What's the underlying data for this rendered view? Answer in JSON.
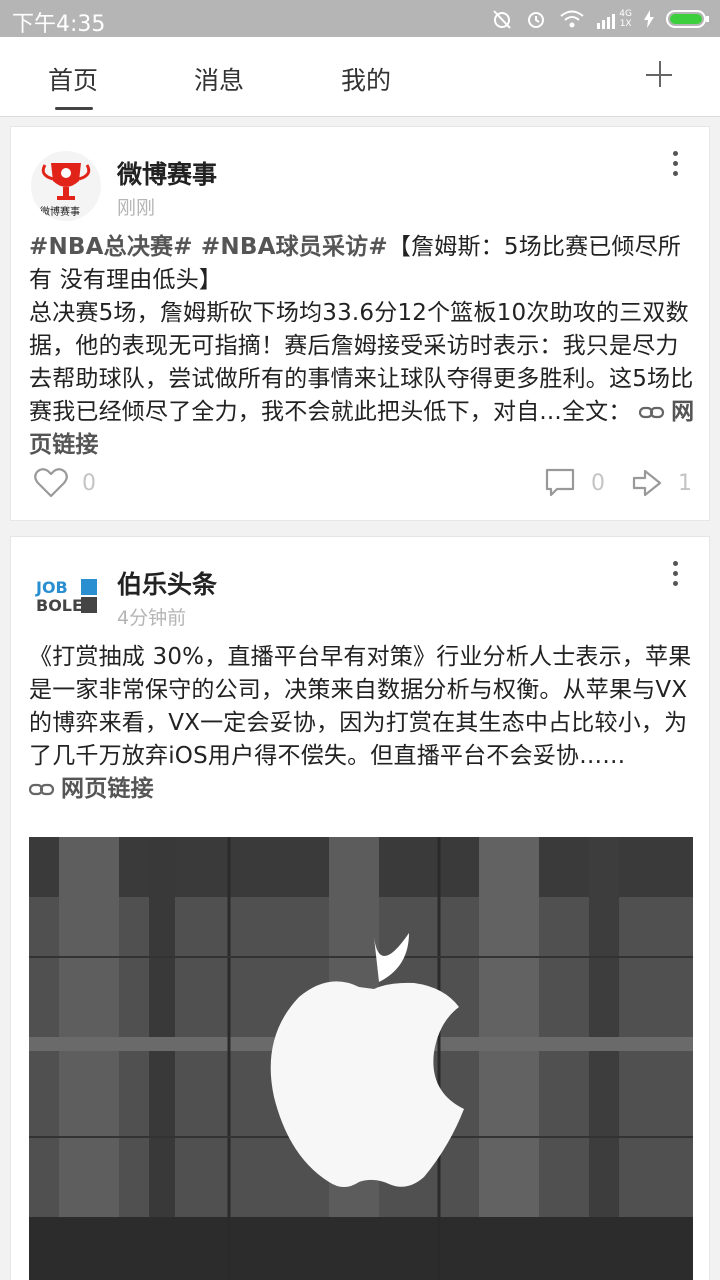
{
  "status_bar": {
    "time": "下午4:35",
    "network_top": "4G",
    "network_bottom": "1X"
  },
  "nav": {
    "tabs": [
      "首页",
      "消息",
      "我的"
    ],
    "active_tab": "首页"
  },
  "posts": [
    {
      "author": "微博赛事",
      "avatar_text": "微博赛事",
      "time": "刚刚",
      "tags": "#NBA总决赛# #NBA球员采访#",
      "title": "【詹姆斯：5场比赛已倾尽所有 没有理由低头】",
      "text": "总决赛5场，詹姆斯砍下场均33.6分12个篮板10次助攻的三双数据，他的表现无可指摘！赛后詹姆接受采访时表示：我只是尽力去帮助球队，尝试做所有的事情来让球队夺得更多胜利。这5场比赛我已经倾尽了全力，我不会就此把头低下，对自...",
      "full_text_label": "全文：",
      "link_label": "网页链接",
      "likes": "0",
      "comments": "0",
      "reposts": "1"
    },
    {
      "author": "伯乐头条",
      "avatar_text_top": "JOB",
      "avatar_text_bottom": "BOLE",
      "time": "4分钟前",
      "text": "《打赏抽成 30%，直播平台早有对策》行业分析人士表示，苹果是一家非常保守的公司，决策来自数据分析与权衡。从苹果与VX的博弈来看，VX一定会妥协，因为打赏在其生态中占比较小，为了几千万放弃iOS用户得不偿失。但直播平台不会妥协……",
      "link_label": "网页链接",
      "image_description": "apple-logo-store-photo"
    }
  ],
  "colors": {
    "status_bar": "#b5b5b5",
    "background": "#f2f2f2",
    "card": "#ffffff",
    "muted": "#c4c4c4",
    "weibo_red": "#e2231a",
    "jobbole_blue": "#2a8fd0"
  }
}
